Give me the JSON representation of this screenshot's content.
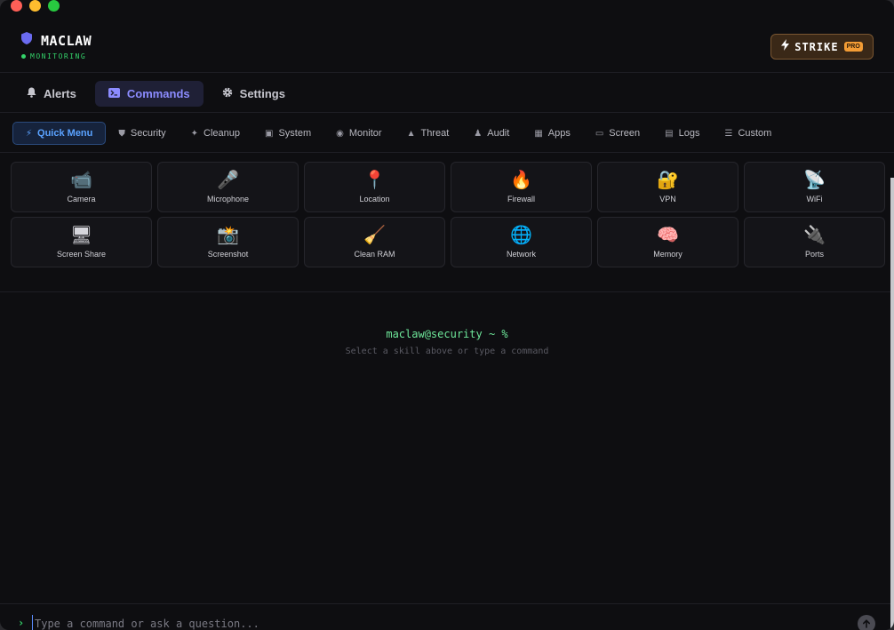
{
  "app": {
    "title": "MACLAW",
    "status": "MONITORING",
    "strike": {
      "label": "STRIKE",
      "badge": "PRO"
    }
  },
  "tabs": [
    {
      "label": "Alerts",
      "icon": "bell-icon"
    },
    {
      "label": "Commands",
      "icon": "terminal-icon",
      "active": true
    },
    {
      "label": "Settings",
      "icon": "gear-icon"
    }
  ],
  "subtabs": [
    {
      "label": "Quick Menu",
      "icon": "bolt-icon",
      "active": true
    },
    {
      "label": "Security",
      "icon": "shield-icon"
    },
    {
      "label": "Cleanup",
      "icon": "sparkle-icon"
    },
    {
      "label": "System",
      "icon": "chip-icon"
    },
    {
      "label": "Monitor",
      "icon": "eye-icon"
    },
    {
      "label": "Threat",
      "icon": "warning-icon"
    },
    {
      "label": "Audit",
      "icon": "people-icon"
    },
    {
      "label": "Apps",
      "icon": "grid-icon"
    },
    {
      "label": "Screen",
      "icon": "monitor-icon"
    },
    {
      "label": "Logs",
      "icon": "terminal-icon"
    },
    {
      "label": "Custom",
      "icon": "scroll-icon"
    }
  ],
  "skills": [
    {
      "label": "Camera",
      "icon": "📹"
    },
    {
      "label": "Microphone",
      "icon": "🎤"
    },
    {
      "label": "Location",
      "icon": "📍"
    },
    {
      "label": "Firewall",
      "icon": "🔥"
    },
    {
      "label": "VPN",
      "icon": "🔐"
    },
    {
      "label": "WiFi",
      "icon": "📡"
    },
    {
      "label": "Screen Share",
      "icon": "🖥"
    },
    {
      "label": "Screenshot",
      "icon": "📸"
    },
    {
      "label": "Clean RAM",
      "icon": "🧹"
    },
    {
      "label": "Network",
      "icon": "🌐"
    },
    {
      "label": "Memory",
      "icon": "🧠"
    },
    {
      "label": "Ports",
      "icon": "🔌"
    }
  ],
  "terminal": {
    "prompt": "maclaw@security ~ %",
    "hint": "Select a skill above or type a command"
  },
  "input": {
    "prompt_symbol": "›",
    "placeholder": "Type a command or ask a question...",
    "value": ""
  },
  "colors": {
    "accent": "#8c8cff",
    "status": "#34d36a",
    "strike": "#f39c35",
    "quick_menu": "#5aa2ff"
  }
}
